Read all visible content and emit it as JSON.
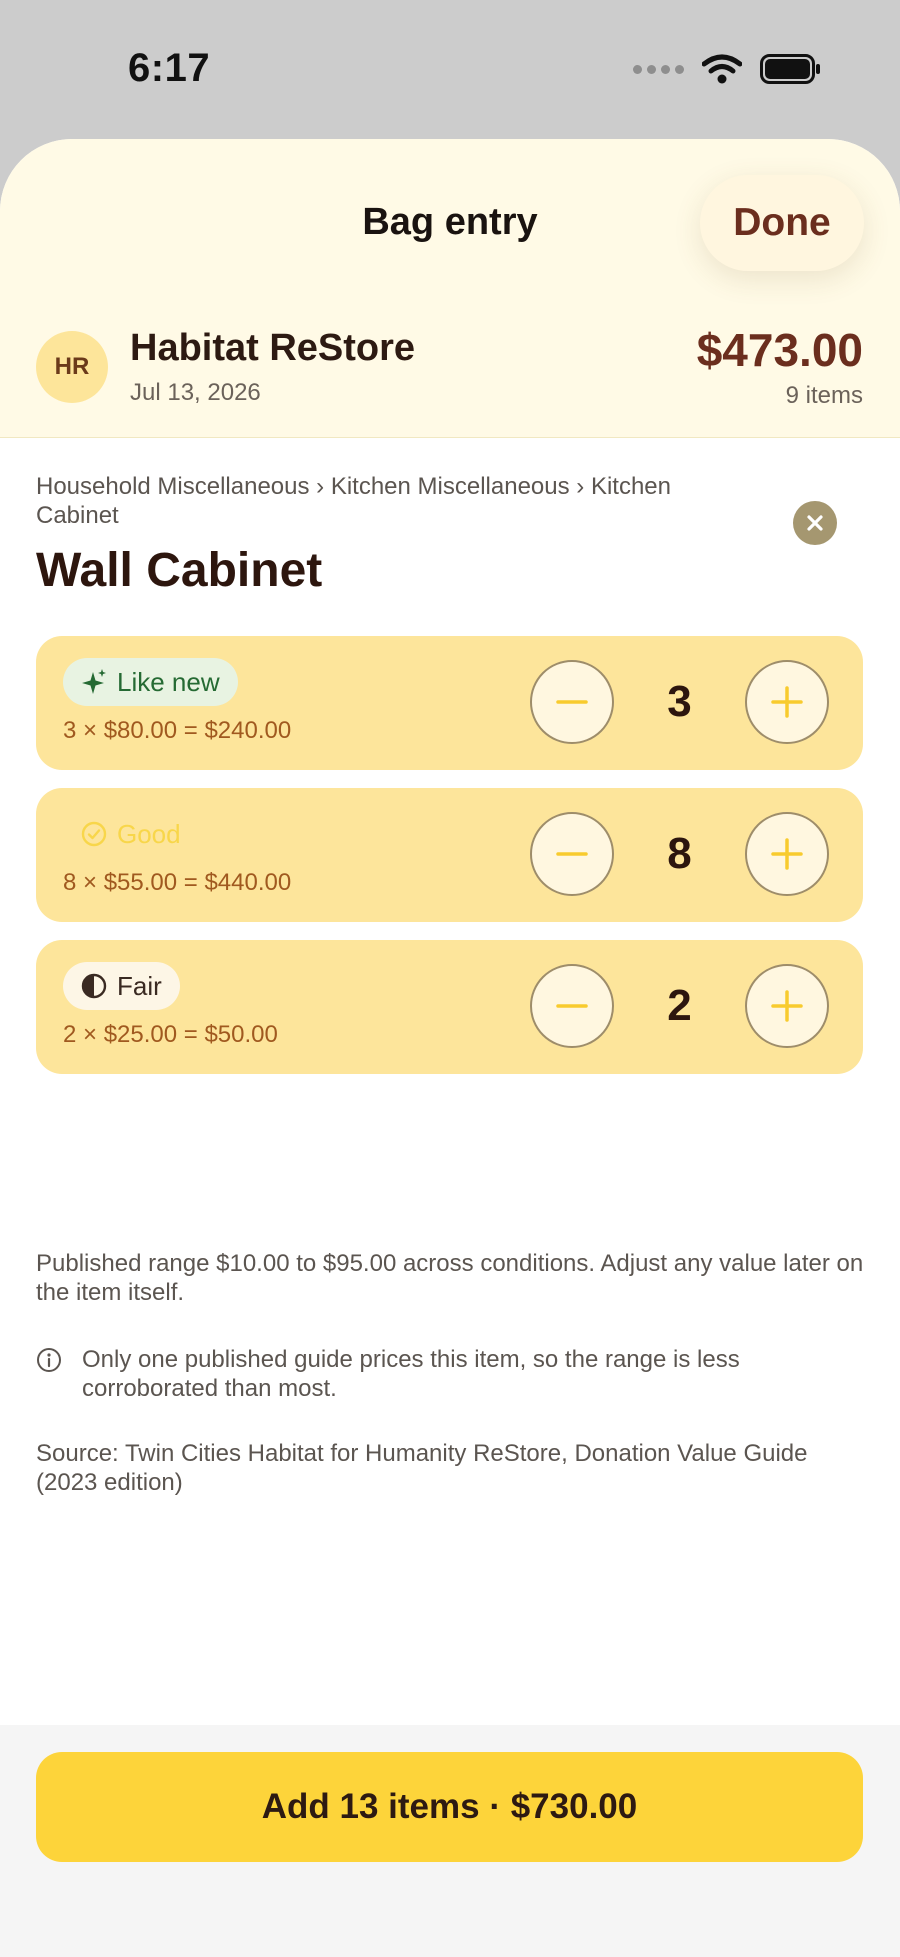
{
  "status_bar": {
    "time": "6:17",
    "icons": [
      "signal-dots-icon",
      "wifi-icon",
      "battery-icon"
    ]
  },
  "sheet": {
    "title": "Bag entry",
    "done_label": "Done"
  },
  "store": {
    "initials": "HR",
    "name": "Habitat ReStore",
    "date": "Jul 13, 2026",
    "total": "$473.00",
    "item_count": "9 items"
  },
  "item": {
    "breadcrumb": "Household Miscellaneous › Kitchen Miscellaneous › Kitchen Cabinet",
    "title": "Wall Cabinet"
  },
  "conditions": [
    {
      "label": "Like new",
      "icon": "sparkles-icon",
      "formula": "3 × $80.00 = $240.00",
      "quantity": "3"
    },
    {
      "label": "Good",
      "icon": "check-circle-icon",
      "formula": "8 × $55.00 = $440.00",
      "quantity": "8"
    },
    {
      "label": "Fair",
      "icon": "half-circle-icon",
      "formula": "2 × $25.00 = $50.00",
      "quantity": "2"
    }
  ],
  "info": {
    "range": "Published range $10.00 to $95.00 across conditions. Adjust any value later on the item itself.",
    "note": "Only one published guide prices this item, so the range is less corroborated than most.",
    "source": "Source: Twin Cities Habitat for Humanity ReStore, Donation Value Guide (2023 edition)"
  },
  "footer": {
    "add_label": "Add 13 items · $730.00"
  },
  "colors": {
    "header_bg": "#fffae6",
    "card_bg": "#fde59b",
    "accent_yellow": "#fdd43a",
    "brown_text": "#6b2e1e",
    "like_new_green": "#256a33"
  }
}
